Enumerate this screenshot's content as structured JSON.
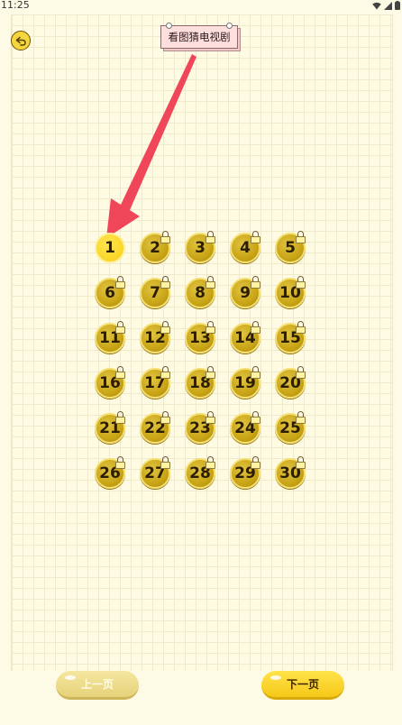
{
  "status_bar": {
    "time": "11:25"
  },
  "header": {
    "title": "看图猜电视剧"
  },
  "levels": [
    {
      "label": "1",
      "locked": false
    },
    {
      "label": "2",
      "locked": true
    },
    {
      "label": "3",
      "locked": true
    },
    {
      "label": "4",
      "locked": true
    },
    {
      "label": "5",
      "locked": true
    },
    {
      "label": "6",
      "locked": true
    },
    {
      "label": "7",
      "locked": true
    },
    {
      "label": "8",
      "locked": true
    },
    {
      "label": "9",
      "locked": true
    },
    {
      "label": "10",
      "locked": true
    },
    {
      "label": "11",
      "locked": true
    },
    {
      "label": "12",
      "locked": true
    },
    {
      "label": "13",
      "locked": true
    },
    {
      "label": "14",
      "locked": true
    },
    {
      "label": "15",
      "locked": true
    },
    {
      "label": "16",
      "locked": true
    },
    {
      "label": "17",
      "locked": true
    },
    {
      "label": "18",
      "locked": true
    },
    {
      "label": "19",
      "locked": true
    },
    {
      "label": "20",
      "locked": true
    },
    {
      "label": "21",
      "locked": true
    },
    {
      "label": "22",
      "locked": true
    },
    {
      "label": "23",
      "locked": true
    },
    {
      "label": "24",
      "locked": true
    },
    {
      "label": "25",
      "locked": true
    },
    {
      "label": "26",
      "locked": true
    },
    {
      "label": "27",
      "locked": true
    },
    {
      "label": "28",
      "locked": true
    },
    {
      "label": "29",
      "locked": true
    },
    {
      "label": "30",
      "locked": true
    }
  ],
  "pagination": {
    "prev_label": "上一页",
    "next_label": "下一页"
  },
  "colors": {
    "background": "#fffbe3",
    "arrow": "#f0465a",
    "coin": "#d4b024",
    "coin_active": "#fcd92a",
    "title_card": "#ffdede"
  },
  "icons": {
    "back": "back-arrow-icon",
    "lock": "lock-icon",
    "pointer": "red-arrow-pointer"
  }
}
